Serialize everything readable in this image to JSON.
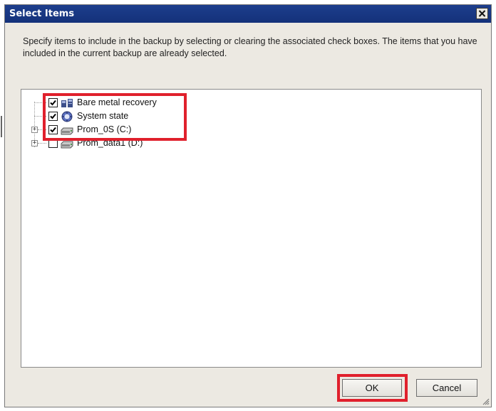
{
  "window": {
    "title": "Select Items"
  },
  "description": "Specify items to include in the backup by selecting or clearing the associated check boxes. The items that you have included in the current backup are already selected.",
  "tree": {
    "items": [
      {
        "label": "Bare metal recovery",
        "checked": true,
        "expandable": false,
        "icon": "bare-metal-recovery-icon"
      },
      {
        "label": "System state",
        "checked": true,
        "expandable": false,
        "icon": "system-state-icon"
      },
      {
        "label": "Prom_0S (C:)",
        "checked": true,
        "expandable": true,
        "icon": "drive-icon"
      },
      {
        "label": "Prom_data1 (D:)",
        "checked": false,
        "expandable": true,
        "icon": "drive-icon"
      }
    ]
  },
  "buttons": {
    "ok": "OK",
    "cancel": "Cancel"
  },
  "colors": {
    "title_bar": "#1d3e8c",
    "highlight": "#e0202c",
    "window_bg": "#ece9e2"
  }
}
